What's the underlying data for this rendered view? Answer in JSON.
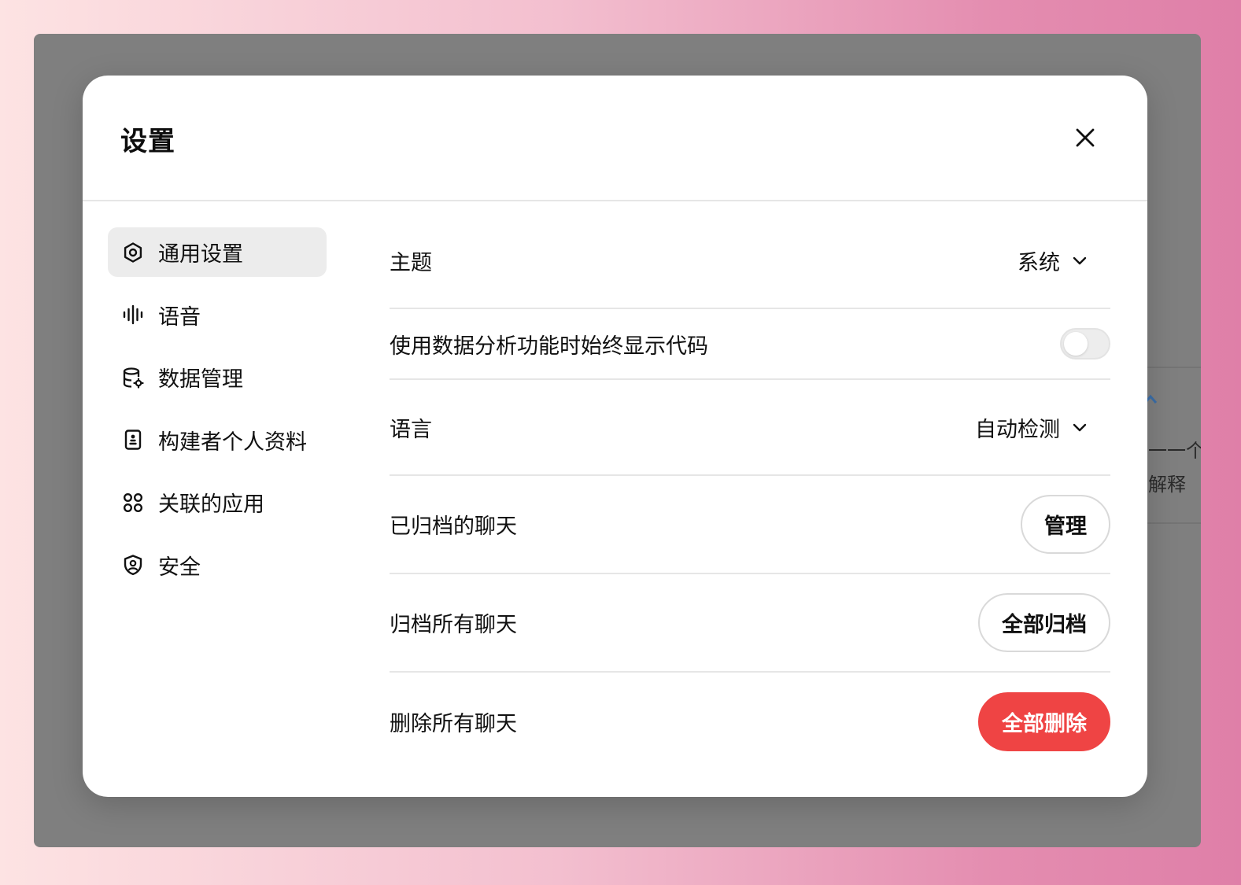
{
  "background_card": {
    "line1": "一一个",
    "line2": "解释"
  },
  "modal": {
    "title": "设置"
  },
  "sidebar": {
    "items": [
      {
        "label": "通用设置",
        "icon": "gear-icon",
        "active": true
      },
      {
        "label": "语音",
        "icon": "audio-wave-icon",
        "active": false
      },
      {
        "label": "数据管理",
        "icon": "database-gear-icon",
        "active": false
      },
      {
        "label": "构建者个人资料",
        "icon": "id-card-icon",
        "active": false
      },
      {
        "label": "关联的应用",
        "icon": "apps-grid-icon",
        "active": false
      },
      {
        "label": "安全",
        "icon": "shield-user-icon",
        "active": false
      }
    ]
  },
  "settings": {
    "theme": {
      "label": "主题",
      "value": "系统"
    },
    "code_toggle": {
      "label": "使用数据分析功能时始终显示代码",
      "enabled": false
    },
    "language": {
      "label": "语言",
      "value": "自动检测"
    },
    "archived": {
      "label": "已归档的聊天",
      "button": "管理"
    },
    "archive_all": {
      "label": "归档所有聊天",
      "button": "全部归档"
    },
    "delete_all": {
      "label": "删除所有聊天",
      "button": "全部删除"
    }
  },
  "colors": {
    "danger": "#ef4444",
    "active_bg": "#ececec",
    "divider": "#e6e6e6"
  }
}
